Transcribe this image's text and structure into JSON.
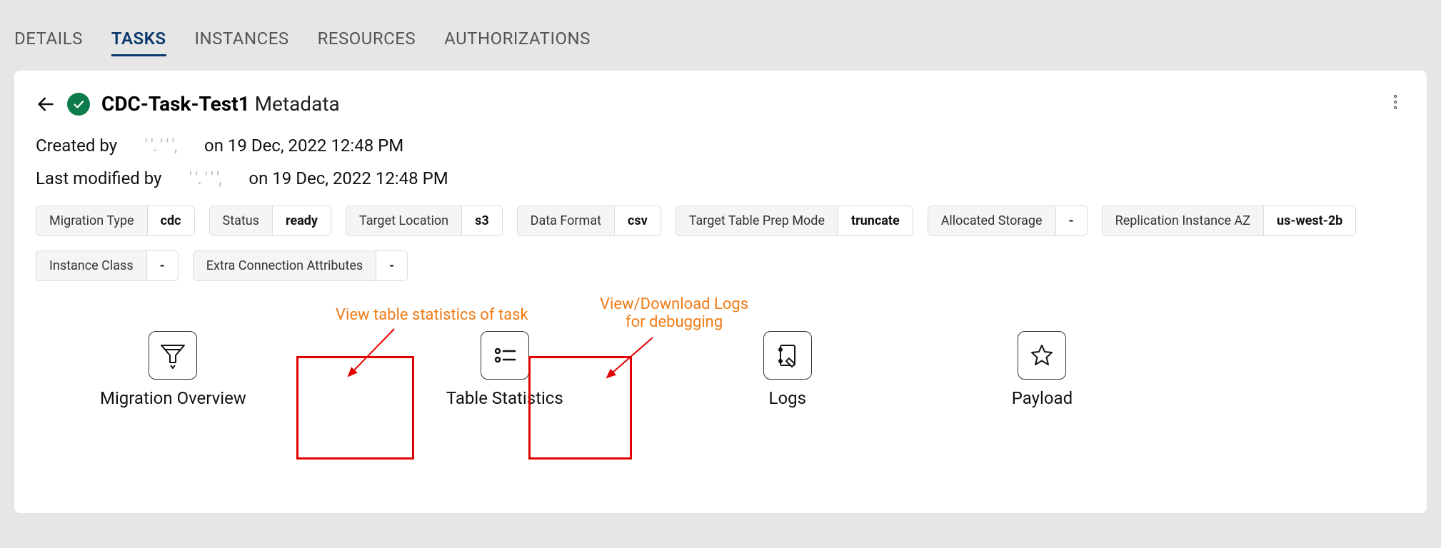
{
  "tabs": {
    "details": "DETAILS",
    "tasks": "TASKS",
    "instances": "INSTANCES",
    "resources": "RESOURCES",
    "authorizations": "AUTHORIZATIONS"
  },
  "header": {
    "task_name": "CDC-Task-Test1",
    "suffix": "Metadata"
  },
  "meta": {
    "created_prefix": "Created by",
    "created_user": "' '. '    ' ',",
    "created_suffix": "on 19 Dec, 2022 12:48 PM",
    "modified_prefix": "Last modified by",
    "modified_user": "' '. '    ' ',",
    "modified_suffix": "on 19 Dec, 2022 12:48 PM"
  },
  "chips": [
    {
      "label": "Migration Type",
      "value": "cdc"
    },
    {
      "label": "Status",
      "value": "ready"
    },
    {
      "label": "Target Location",
      "value": "s3"
    },
    {
      "label": "Data Format",
      "value": "csv"
    },
    {
      "label": "Target Table Prep Mode",
      "value": "truncate"
    },
    {
      "label": "Allocated Storage",
      "value": "-"
    },
    {
      "label": "Replication Instance AZ",
      "value": "us-west-2b"
    },
    {
      "label": "Instance Class",
      "value": "-"
    },
    {
      "label": "Extra Connection Attributes",
      "value": "-"
    }
  ],
  "actions": {
    "migration_overview": "Migration Overview",
    "table_statistics": "Table Statistics",
    "logs": "Logs",
    "payload": "Payload"
  },
  "annotations": {
    "table_stats": "View table statistics of task",
    "logs_line1": "View/Download Logs",
    "logs_line2": "for debugging"
  }
}
